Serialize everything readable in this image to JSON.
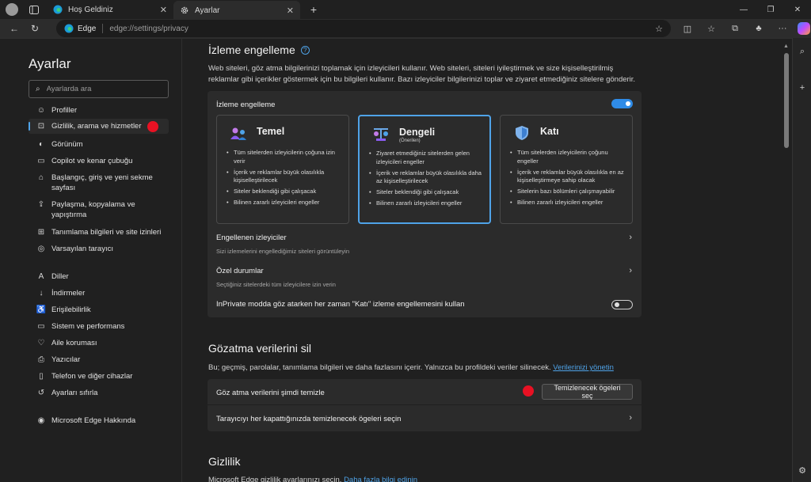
{
  "tabs": [
    {
      "title": "Hoş Geldiniz"
    },
    {
      "title": "Ayarlar"
    }
  ],
  "address": {
    "label": "Edge",
    "url": "edge://settings/privacy"
  },
  "settings": {
    "title": "Ayarlar",
    "search_placeholder": "Ayarlarda ara",
    "nav": [
      {
        "label": "Profiller",
        "icon": "profile-icon"
      },
      {
        "label": "Gizlilik, arama ve hizmetler",
        "icon": "lock-icon"
      },
      {
        "label": "Görünüm",
        "icon": "appearance-icon"
      },
      {
        "label": "Copilot ve kenar çubuğu",
        "icon": "sidebar-icon"
      },
      {
        "label": "Başlangıç, giriş ve yeni sekme sayfası",
        "icon": "start-icon"
      },
      {
        "label": "Paylaşma, kopyalama ve yapıştırma",
        "icon": "share-icon"
      },
      {
        "label": "Tanımlama bilgileri ve site izinleri",
        "icon": "cookie-icon"
      },
      {
        "label": "Varsayılan tarayıcı",
        "icon": "browser-icon"
      },
      {
        "label": "Diller",
        "icon": "language-icon"
      },
      {
        "label": "İndirmeler",
        "icon": "download-icon"
      },
      {
        "label": "Erişilebilirlik",
        "icon": "accessibility-icon"
      },
      {
        "label": "Sistem ve performans",
        "icon": "system-icon"
      },
      {
        "label": "Aile koruması",
        "icon": "family-icon"
      },
      {
        "label": "Yazıcılar",
        "icon": "printer-icon"
      },
      {
        "label": "Telefon ve diğer cihazlar",
        "icon": "phone-icon"
      },
      {
        "label": "Ayarları sıfırla",
        "icon": "reset-icon"
      },
      {
        "label": "Microsoft Edge Hakkında",
        "icon": "edge-icon"
      }
    ]
  },
  "tracking": {
    "heading": "İzleme engelleme",
    "description": "Web siteleri, göz atma bilgilerinizi toplamak için izleyicileri kullanır. Web siteleri, siteleri iyileştirmek ve size kişiselleştirilmiş reklamlar gibi içerikler göstermek için bu bilgileri kullanır. Bazı izleyiciler bilgilerinizi toplar ve ziyaret etmediğiniz sitelere gönderir.",
    "toggle_label": "İzleme engelleme",
    "toggle_on": true,
    "options": [
      {
        "title": "Temel",
        "subtitle": "",
        "selected": false,
        "bullets": [
          "Tüm sitelerden izleyicilerin çoğuna izin verir",
          "İçerik ve reklamlar büyük olasılıkla kişiselleştirilecek",
          "Siteler beklendiği gibi çalışacak",
          "Bilinen zararlı izleyicileri engeller"
        ]
      },
      {
        "title": "Dengeli",
        "subtitle": "(Önerilen)",
        "selected": true,
        "bullets": [
          "Ziyaret etmediğiniz sitelerden gelen izleyicileri engeller",
          "İçerik ve reklamlar büyük olasılıkla daha az kişiselleştirilecek",
          "Siteler beklendiği gibi çalışacak",
          "Bilinen zararlı izleyicileri engeller"
        ]
      },
      {
        "title": "Katı",
        "subtitle": "",
        "selected": false,
        "bullets": [
          "Tüm sitelerden izleyicilerin çoğunu engeller",
          "İçerik ve reklamlar büyük olasılıkla en az kişiselleştirmeye sahip olacak",
          "Sitelerin bazı bölümleri çalışmayabilir",
          "Bilinen zararlı izleyicileri engeller"
        ]
      }
    ],
    "blocked_title": "Engellenen izleyiciler",
    "blocked_sub": "Sizi izlemelerini engellediğimiz siteleri görüntüleyin",
    "exceptions_title": "Özel durumlar",
    "exceptions_sub": "Seçtiğiniz sitelerdeki tüm izleyicilere izin verin",
    "inprivate_label": "InPrivate modda göz atarken her zaman \"Katı\" izleme engellemesini kullan",
    "inprivate_on": false
  },
  "browsing": {
    "heading": "Gözatma verilerini sil",
    "description": "Bu; geçmiş, parolalar, tanımlama bilgileri ve daha fazlasını içerir. Yalnızca bu profildeki veriler silinecek.",
    "manage_link": "Verilerinizi yönetin",
    "clear_now": "Göz atma verilerini şimdi temizle",
    "choose_button": "Temizlenecek ögeleri seç",
    "on_close": "Tarayıcıyı her kapattığınızda temizlenecek ögeleri seçin"
  },
  "privacy": {
    "heading": "Gizlilik",
    "description": "Microsoft Edge gizlilik ayarlarınızı seçin.",
    "link": "Daha fazla bilgi edinin"
  },
  "colors": {
    "accent": "#4fa3e8",
    "marker": "#e81123"
  }
}
